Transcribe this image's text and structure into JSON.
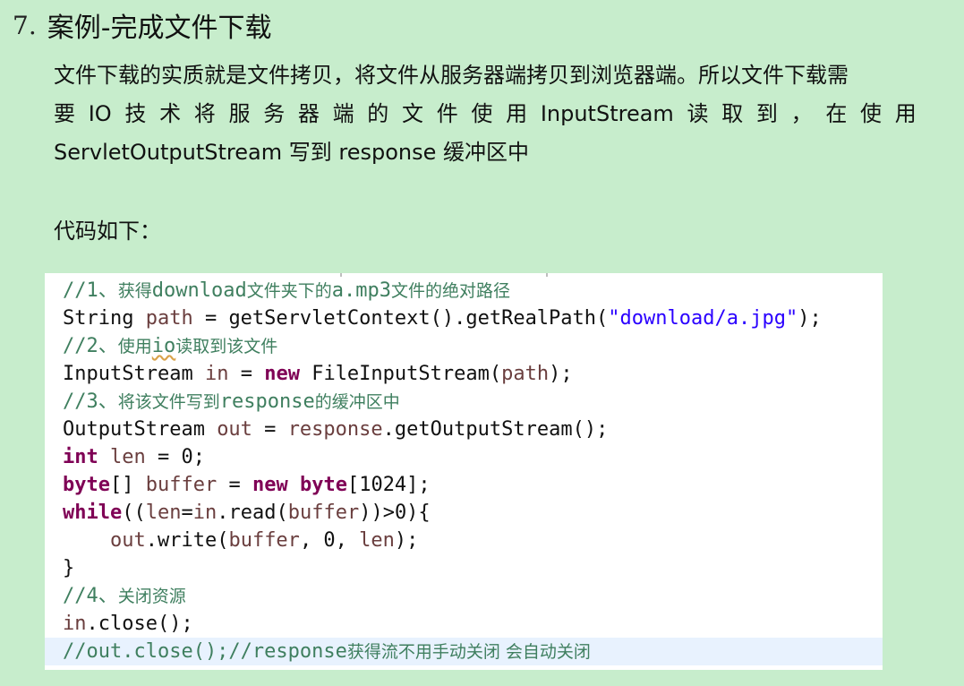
{
  "heading": {
    "number": "7.",
    "title": "案例-完成文件下载"
  },
  "description": {
    "line1": "文件下载的实质就是文件拷贝，将文件从服务器端拷贝到浏览器端。所以文件下载需",
    "line2_tokens": [
      "要",
      "IO",
      "技",
      "术",
      "将",
      "服",
      "务",
      "器",
      "端",
      "的",
      "文",
      "件",
      "使",
      "用",
      "InputStream",
      "读",
      "取",
      "到",
      "，",
      "在",
      "使",
      "用"
    ],
    "line3": "ServletOutputStream 写到 response 缓冲区中"
  },
  "code_label": "代码如下：",
  "code": {
    "c1_prefix": "//1、",
    "c1_cn1": "获得",
    "c1_mid": "download",
    "c1_cn2": "文件夹下的",
    "c1_mid2": "a.mp3",
    "c1_cn3": "文件的绝对路径",
    "l2_a": "String ",
    "l2_var": "path",
    "l2_b": " = getServletContext().getRealPath(",
    "l2_str": "\"download/a.jpg\"",
    "l2_c": ");",
    "c3_prefix": "//2、",
    "c3_cn1": "使用",
    "c3_io": "io",
    "c3_cn2": "读取到该文件",
    "l4_a": "InputStream ",
    "l4_var": "in",
    "l4_b": " = ",
    "l4_kw": "new",
    "l4_c": " FileInputStream(",
    "l4_var2": "path",
    "l4_d": ");",
    "c5_prefix": "//3、",
    "c5_cn1": "将该文件写到",
    "c5_mid": "response",
    "c5_cn2": "的缓冲区中",
    "l6_a": "OutputStream ",
    "l6_var": "out",
    "l6_b": " = ",
    "l6_var2": "response",
    "l6_c": ".getOutputStream();",
    "l7_kw": "int",
    "l7_a": " ",
    "l7_var": "len",
    "l7_b": " = 0;",
    "l8_kw": "byte",
    "l8_a": "[] ",
    "l8_var": "buffer",
    "l8_b": " = ",
    "l8_kw2": "new",
    "l8_c": " ",
    "l8_kw3": "byte",
    "l8_d": "[1024];",
    "l9_kw": "while",
    "l9_a": "((",
    "l9_var": "len",
    "l9_b": "=",
    "l9_var2": "in",
    "l9_c": ".read(",
    "l9_var3": "buffer",
    "l9_d": "))>0){",
    "l10_indent": "    ",
    "l10_var": "out",
    "l10_a": ".write(",
    "l10_var2": "buffer",
    "l10_b": ", 0, ",
    "l10_var3": "len",
    "l10_c": ");",
    "l11": "}",
    "c12_prefix": "//4、",
    "c12_cn": "关闭资源",
    "l13_var": "in",
    "l13_a": ".close();",
    "c14_prefix": "//out.close();//response",
    "c14_cn": "获得流不用手动关闭 会自动关闭"
  }
}
